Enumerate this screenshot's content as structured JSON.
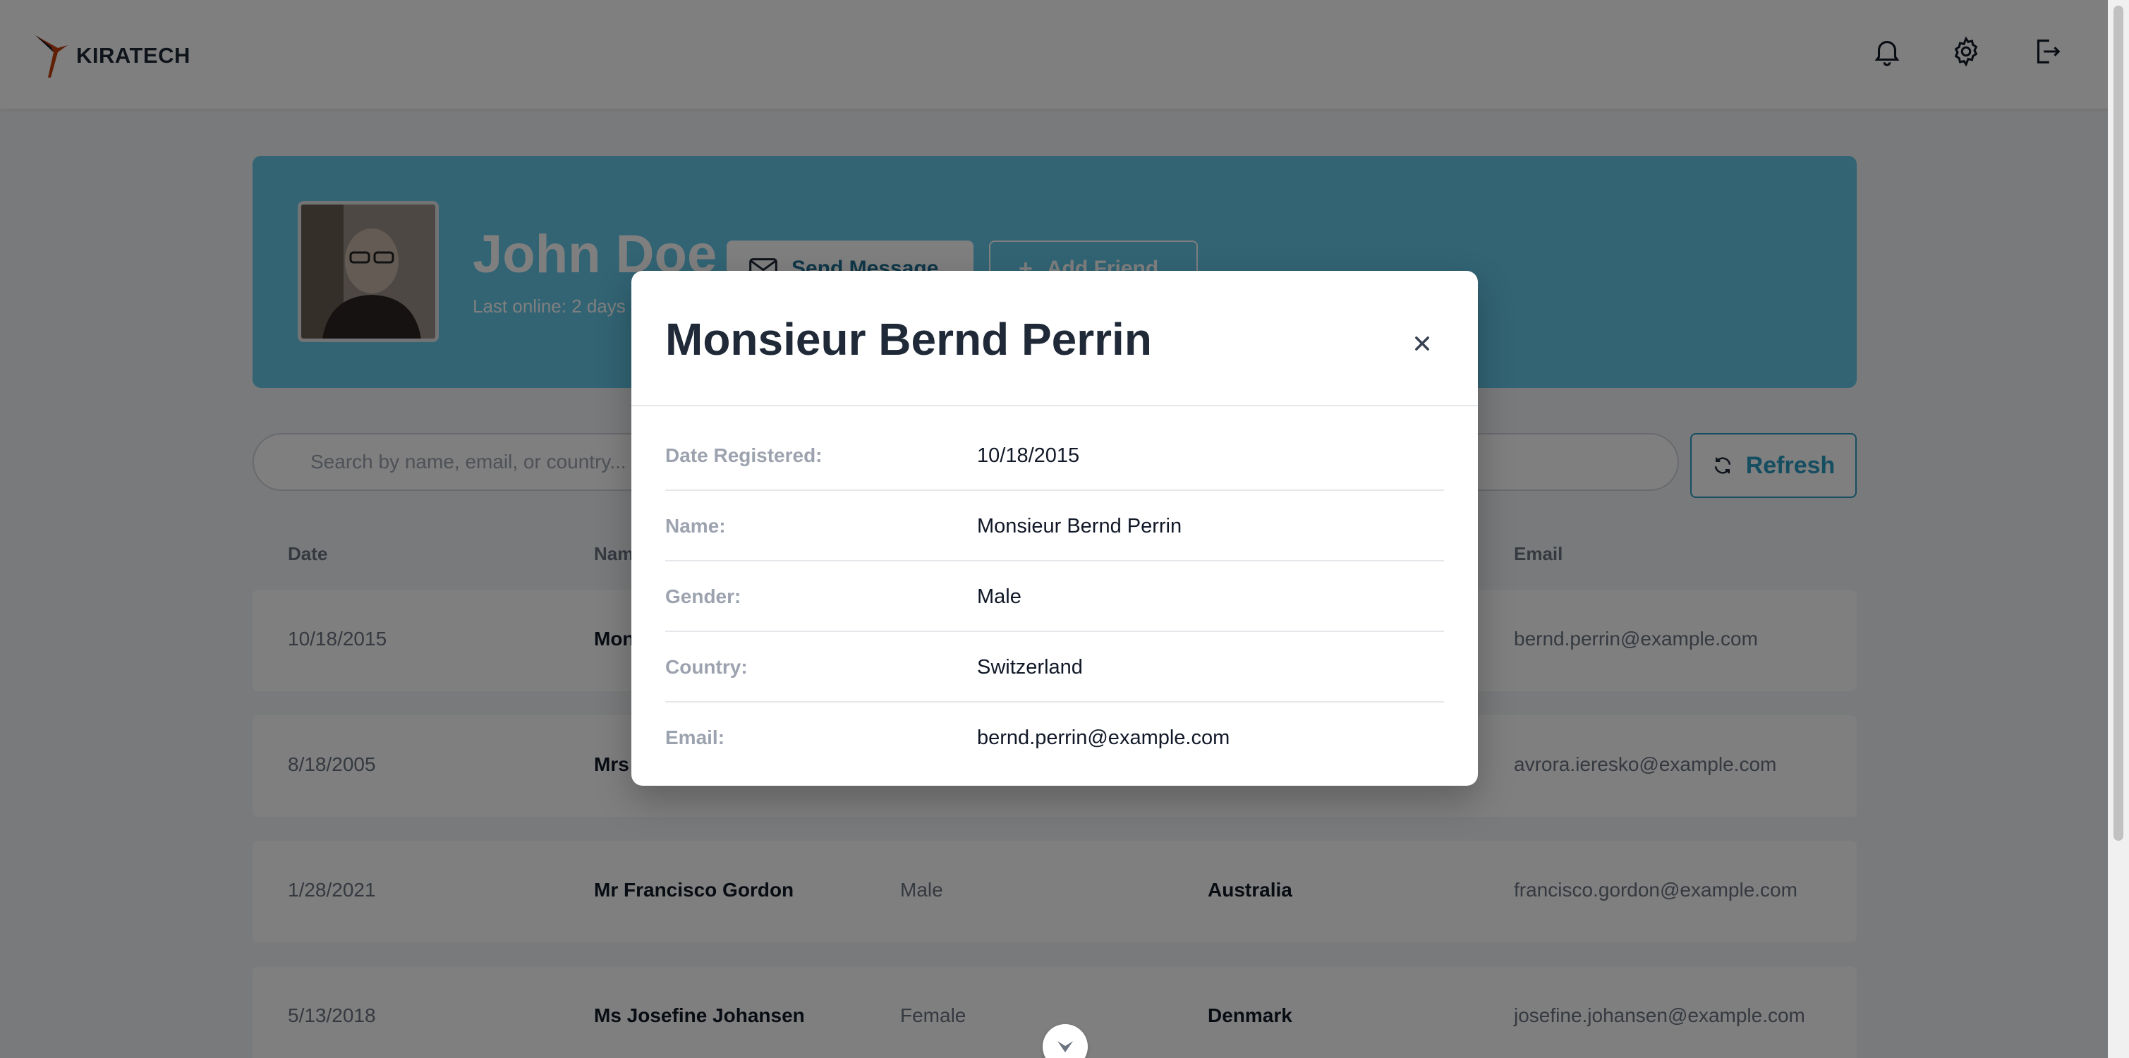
{
  "app": {
    "brand": "KIRATECH"
  },
  "profile": {
    "name": "John Doe",
    "last_online": "Last online: 2 days",
    "send_message_label": "Send Message",
    "add_friend_label": "Add Friend"
  },
  "search": {
    "placeholder": "Search by name, email, or country..."
  },
  "refresh_label": "Refresh",
  "table": {
    "headers": {
      "date": "Date",
      "name": "Name",
      "email": "Email"
    },
    "rows": [
      {
        "date": "10/18/2015",
        "name": "Mon",
        "gender": "",
        "country": "",
        "email": "bernd.perrin@example.com"
      },
      {
        "date": "8/18/2005",
        "name": "Mrs",
        "gender": "",
        "country": "",
        "email": "avrora.ieresko@example.com"
      },
      {
        "date": "1/28/2021",
        "name": "Mr Francisco Gordon",
        "gender": "Male",
        "country": "Australia",
        "email": "francisco.gordon@example.com"
      },
      {
        "date": "5/13/2018",
        "name": "Ms Josefine Johansen",
        "gender": "Female",
        "country": "Denmark",
        "email": "josefine.johansen@example.com"
      }
    ]
  },
  "modal": {
    "title": "Monsieur Bernd Perrin",
    "details": [
      {
        "label": "Date Registered:",
        "value": "10/18/2015"
      },
      {
        "label": "Name:",
        "value": "Monsieur Bernd Perrin"
      },
      {
        "label": "Gender:",
        "value": "Male"
      },
      {
        "label": "Country:",
        "value": "Switzerland"
      },
      {
        "label": "Email:",
        "value": "bernd.perrin@example.com"
      }
    ]
  },
  "icons": {
    "notifications": "bell-icon",
    "settings": "gear-icon",
    "logout": "logout-icon",
    "close": "close-icon",
    "refresh": "refresh-icon",
    "mail": "mail-icon",
    "scroll_down": "chevron-down-icon"
  },
  "colors": {
    "banner": "#65c9e8",
    "accent": "#2a9bc3",
    "overlay": "rgba(0,0,0,0.5)"
  }
}
